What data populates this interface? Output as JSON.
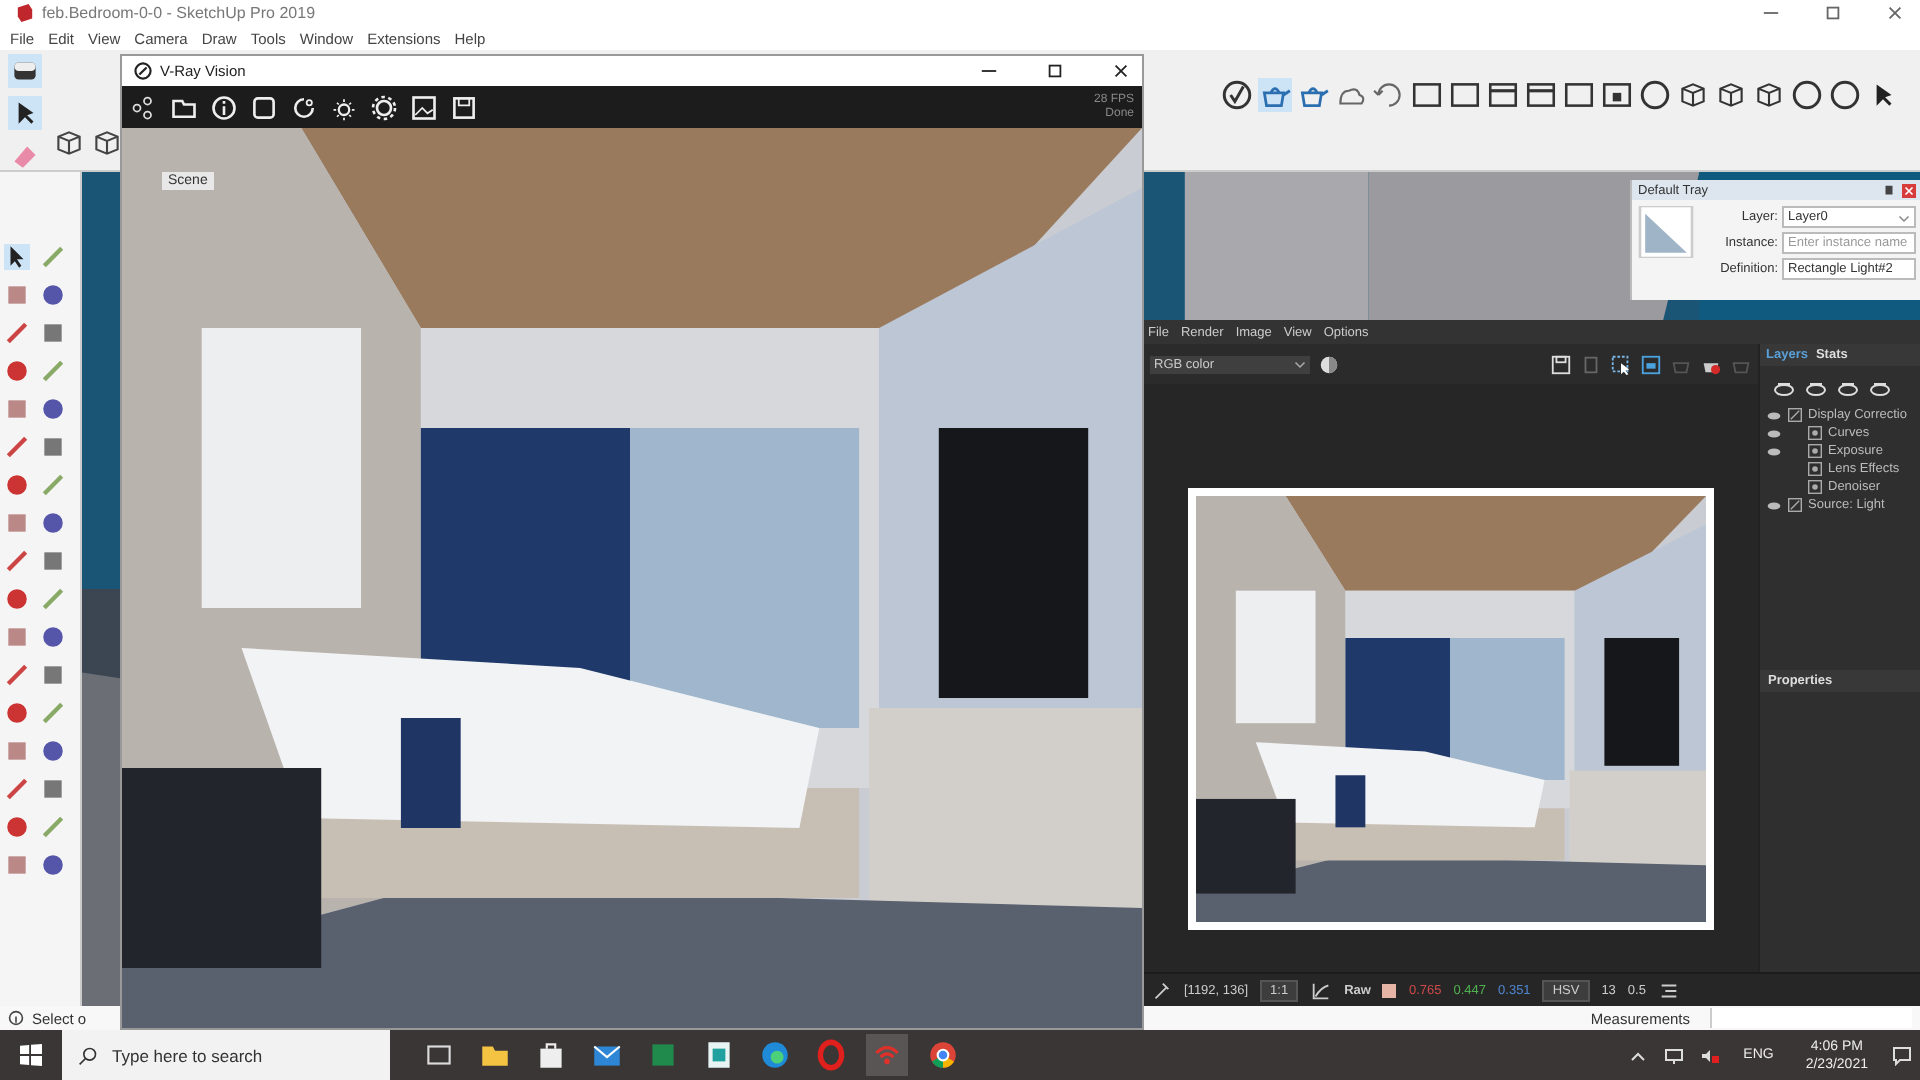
{
  "sketchup": {
    "title": "feb.Bedroom-0-0 - SketchUp Pro 2019",
    "menu": [
      "File",
      "Edit",
      "View",
      "Camera",
      "Draw",
      "Tools",
      "Window",
      "Extensions",
      "Help"
    ],
    "scene_tab": "Scene",
    "status": "Select o",
    "measurements_label": "Measurements"
  },
  "vray_vision": {
    "title": "V-Ray Vision",
    "fps": "28 FPS",
    "status": "Done"
  },
  "default_tray": {
    "title": "Default Tray",
    "fields": [
      {
        "label": "Layer:",
        "value": "Layer0",
        "kind": "dropdown"
      },
      {
        "label": "Instance:",
        "placeholder": "Enter instance name",
        "kind": "text"
      },
      {
        "label": "Definition:",
        "value": "Rectangle Light#2",
        "kind": "text"
      }
    ]
  },
  "frame_buffer": {
    "menu": [
      "File",
      "Render",
      "Image",
      "View",
      "Options"
    ],
    "channel": "RGB color",
    "panel_tabs": [
      {
        "label": "Layers",
        "selected": true
      },
      {
        "label": "Stats",
        "selected": false
      }
    ],
    "layers": [
      {
        "name": "Display Correctio",
        "visible": true,
        "children": [
          {
            "name": "Curves",
            "visible": true
          },
          {
            "name": "Exposure",
            "visible": true
          },
          {
            "name": "Lens Effects",
            "visible": false
          },
          {
            "name": "Denoiser",
            "visible": false
          }
        ]
      },
      {
        "name": "Source: Light",
        "visible": true
      }
    ],
    "properties_title": "Properties",
    "status_bar": {
      "coords": "[1192, 136]",
      "zoom": "1:1",
      "mode": "Raw",
      "values": [
        {
          "text": "0.765",
          "color": "#d04a4a"
        },
        {
          "text": "0.447",
          "color": "#4fb04f"
        },
        {
          "text": "0.351",
          "color": "#4f86d0"
        }
      ],
      "color_space": "HSV",
      "field_1": "13",
      "field_2": "0.5"
    }
  },
  "taskbar": {
    "search_placeholder": "Type here to search",
    "language": "ENG",
    "time": "4:06 PM",
    "date": "2/23/2021"
  }
}
